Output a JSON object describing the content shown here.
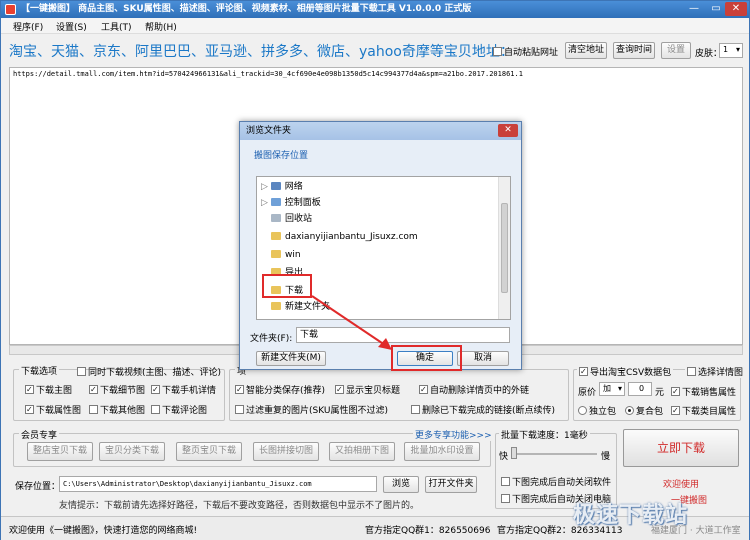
{
  "window": {
    "title": "【一键搬图】 商品主图、SKU属性图、描述图、评论图、视频素材、相册等图片批量下载工具 V1.0.0.0 正式版",
    "minimize": "—",
    "restore": "▭",
    "close": "✕"
  },
  "menu": [
    "程序(F)",
    "设置(S)",
    "工具(T)",
    "帮助(H)"
  ],
  "header": {
    "platforms": "淘宝、天猫、京东、阿里巴巴、亚马逊、拼多多、微店、yahoo奇摩等宝贝地址：",
    "auto_paste": "自动粘贴网址",
    "clear_btn": "清空地址",
    "query_btn": "查询时间",
    "settings_btn": "设置",
    "skin_label": "皮肤：",
    "skin_value": "1"
  },
  "url_text": "https://detail.tmall.com/item.htm?id=570424966131&ali_trackid=30_4cf690e4e098b1350d5c14c994377d4a&spm=a21bo.2017.201861.1",
  "download_options": {
    "legend": "下载选项",
    "sync_video": "同时下载视频(主图、描述、评论)",
    "items": [
      "下载主图",
      "下载细节图",
      "下载手机详情",
      "下载属性图",
      "下载其他图",
      "下载评论图"
    ]
  },
  "middle_options": {
    "legend": "项",
    "items": [
      "智能分类保存(推荐)",
      "显示宝贝标题",
      "自动删除详情页中的外链",
      "过滤重复的图片(SKU属性图不过滤)",
      "删除已下载完成的链接(断点续传)"
    ]
  },
  "right_options": {
    "export_csv": "导出淘宝CSV数据包",
    "select_detail": "选择详情图",
    "price_label": "原价",
    "price_op": "加",
    "price_value": "0",
    "price_unit": "元",
    "sales_attr": "下载销售属性",
    "single_pkg": "独立包",
    "combined_pkg": "复合包",
    "category_attr": "下载类目属性"
  },
  "member": {
    "legend": "会员专享",
    "more": "更多专享功能>>>",
    "buttons": [
      "整店宝贝下载",
      "宝贝分类下载",
      "整页宝贝下载",
      "长图拼接切图",
      "又拍相册下图",
      "批量加水印设置"
    ]
  },
  "save": {
    "label": "保存位置：",
    "path": "C:\\Users\\Administrator\\Desktop\\daxianyijianbantu_Jisuxz.com",
    "browse": "浏览",
    "open": "打开文件夹",
    "tip": "友情提示：下载前请先选择好路径，下载后不要改变路径，否则数据包中显示不了图片的。"
  },
  "speed": {
    "legend": "批量下载速度：1毫秒",
    "fast": "快",
    "slow": "慢",
    "auto_shutdown": "下图完成后自动关闭软件",
    "auto_poweroff": "下图完成后自动关闭电脑"
  },
  "start": {
    "button": "立即下载",
    "welcome": "欢迎使用",
    "brand": "一键搬图"
  },
  "status": {
    "welcome": "欢迎使用《一键搬图》，快速打造您的网络商城!",
    "qq1": "官方指定QQ群1：826550696",
    "qq2": "官方指定QQ群2：826334113",
    "company": "福建厦门 · 大道工作室"
  },
  "watermark": "极速下载站",
  "dialog": {
    "title": "浏览文件夹",
    "close": "✕",
    "subtitle": "搬图保存位置",
    "tree": [
      "网络",
      "控制面板",
      "回收站",
      "daxianyijianbantu_Jisuxz.com",
      "win",
      "导出",
      "下载",
      "新建文件夹"
    ],
    "folder_label": "文件夹(F):",
    "folder_value": "下载",
    "new_folder": "新建文件夹(M)",
    "ok": "确定",
    "cancel": "取消"
  },
  "colors": {
    "accent": "#1b78c7",
    "highlight": "#e02a2a",
    "brand_red": "#d12a2a"
  }
}
